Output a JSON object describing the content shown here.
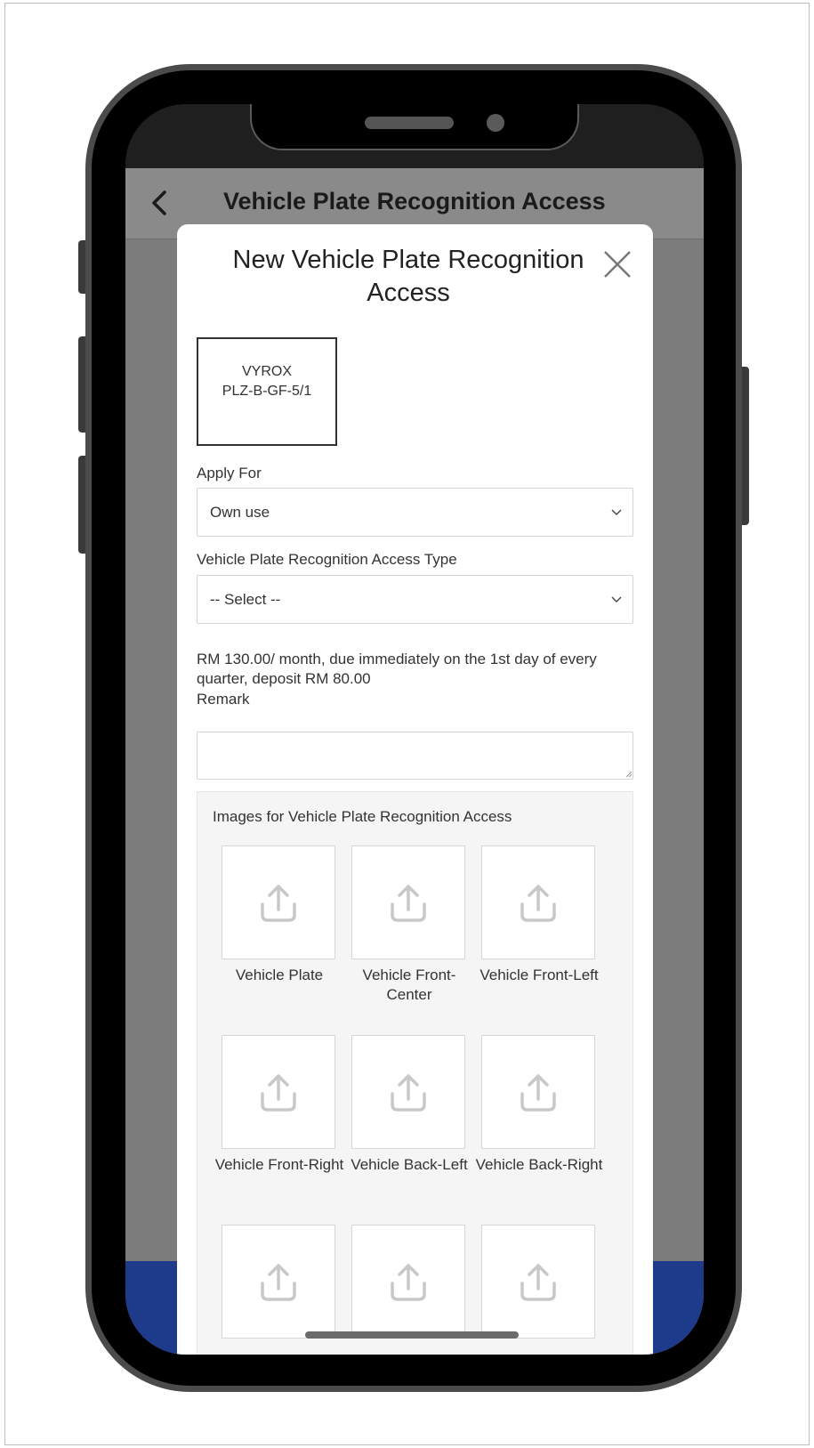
{
  "header": {
    "title": "Vehicle Plate Recognition Access"
  },
  "modal": {
    "title": "New Vehicle Plate Recognition Access",
    "unit": {
      "line1": "VYROX",
      "line2": "PLZ-B-GF-5/1"
    },
    "apply_for": {
      "label": "Apply For",
      "value": "Own use"
    },
    "access_type": {
      "label": "Vehicle Plate Recognition Access Type",
      "value": "-- Select --"
    },
    "price_note": "RM 130.00/ month, due immediately on the 1st day of every quarter, deposit RM 80.00",
    "remark": {
      "label": "Remark",
      "value": "",
      "placeholder": ""
    },
    "images": {
      "title": "Images for Vehicle Plate Recognition Access",
      "items": [
        {
          "label": "Vehicle Plate",
          "icon": "upload-icon"
        },
        {
          "label": "Vehicle Front-Center",
          "icon": "upload-icon"
        },
        {
          "label": "Vehicle Front-Left",
          "icon": "upload-icon"
        },
        {
          "label": "Vehicle Front-Right",
          "icon": "upload-icon"
        },
        {
          "label": "Vehicle Back-Left",
          "icon": "upload-icon"
        },
        {
          "label": "Vehicle Back-Right",
          "icon": "upload-icon"
        },
        {
          "label": "",
          "icon": "upload-icon"
        },
        {
          "label": "",
          "icon": "upload-icon"
        },
        {
          "label": "",
          "icon": "upload-icon"
        }
      ]
    }
  },
  "colors": {
    "header_bg": "#8a8a8a",
    "overlay_bg": "#7c7c7c",
    "brand_blue": "#1e3a8a",
    "modal_bg": "#ffffff",
    "panel_bg": "#f5f5f5",
    "icon_gray": "#c8c8c8"
  }
}
